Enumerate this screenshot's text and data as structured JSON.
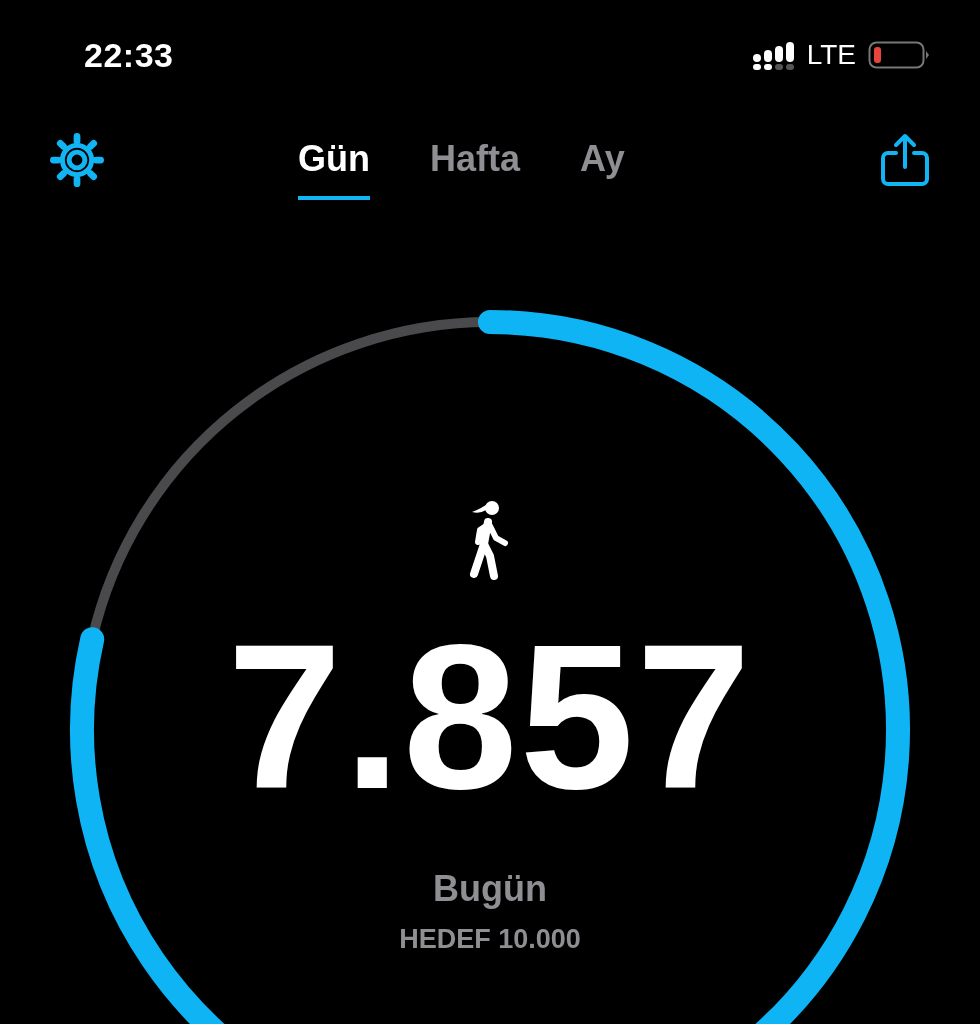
{
  "status_bar": {
    "time": "22:33",
    "network": "LTE"
  },
  "tabs": [
    {
      "label": "Gün",
      "selected": true
    },
    {
      "label": "Hafta",
      "selected": false
    },
    {
      "label": "Ay",
      "selected": false
    }
  ],
  "steps": {
    "count": "7.857",
    "label": "Bugün",
    "goal": "HEDEF 10.000"
  }
}
